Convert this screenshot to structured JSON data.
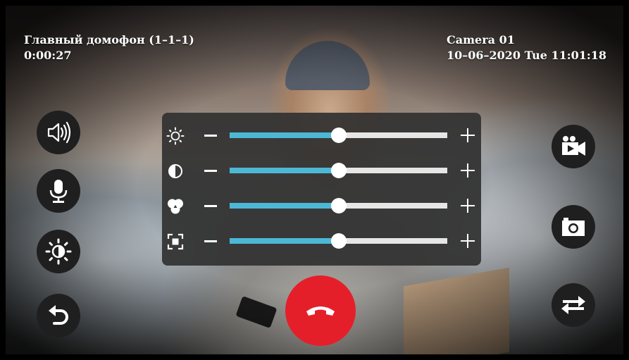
{
  "header": {
    "title": "Главный домофон (1–1–1)",
    "timer": "0:00:27",
    "camera_name": "Camera 01",
    "datetime": "10–06–2020 Tue 11:01:18"
  },
  "left_buttons": [
    "speaker-icon",
    "microphone-icon",
    "brightness-contrast-icon",
    "back-arrow-icon"
  ],
  "right_buttons": [
    "video-record-icon",
    "camera-snapshot-icon",
    "switch-arrows-icon"
  ],
  "hangup": {
    "icon": "phone-hangup-icon",
    "color": "#e51f2a"
  },
  "adjust_panel": {
    "accent_color": "#4db8d6",
    "sliders": [
      {
        "name": "brightness",
        "icon": "sun-icon",
        "value": 0.5
      },
      {
        "name": "contrast",
        "icon": "contrast-icon",
        "value": 0.5
      },
      {
        "name": "color",
        "icon": "color-saturation-icon",
        "value": 0.5
      },
      {
        "name": "zoom",
        "icon": "focus-frame-icon",
        "value": 0.5
      }
    ]
  }
}
